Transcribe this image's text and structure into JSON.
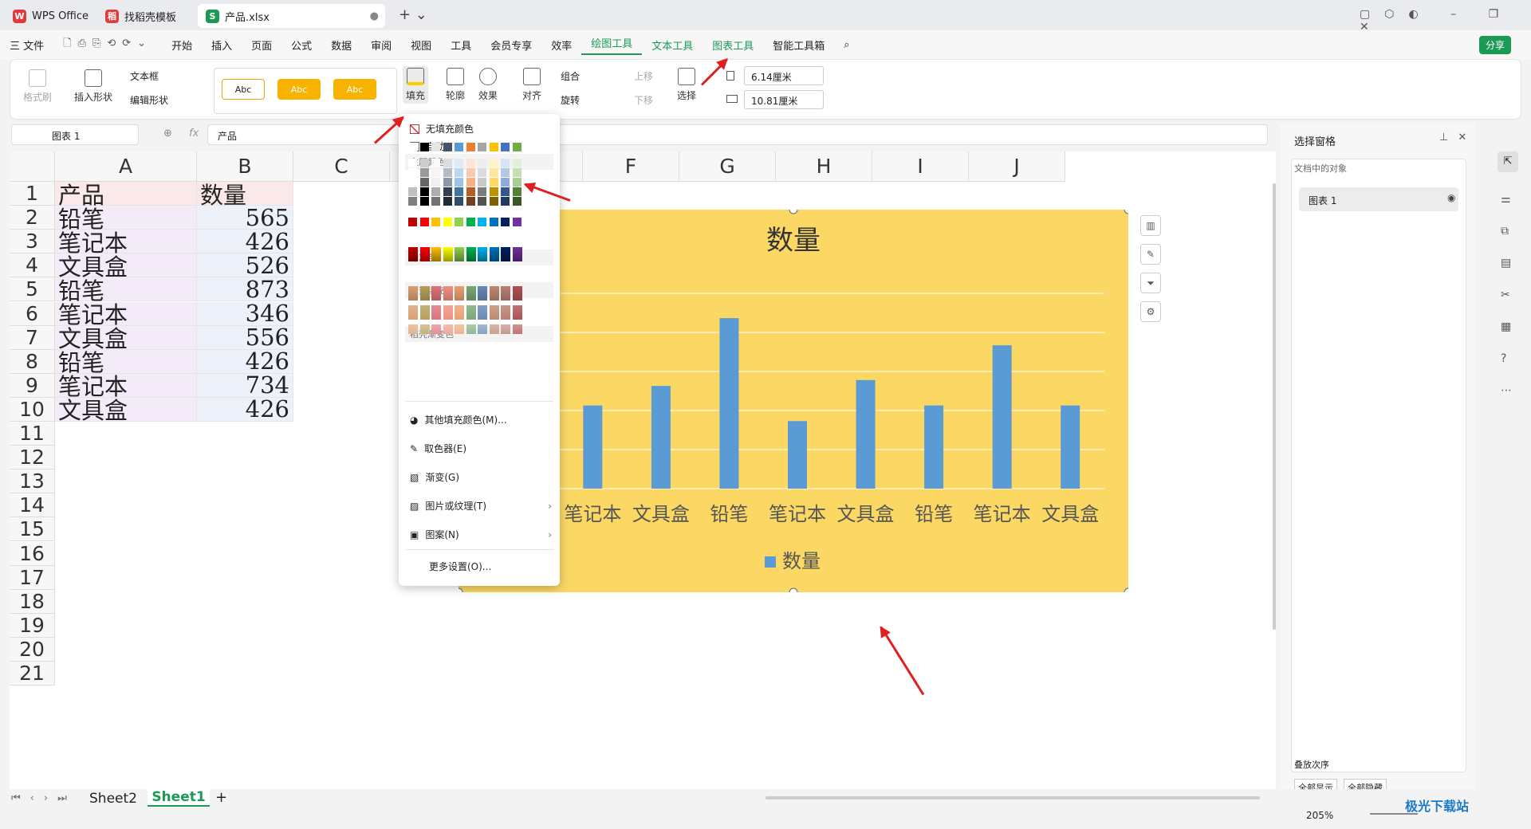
{
  "tabs": [
    {
      "label": "WPS Office",
      "logo": "W",
      "color": "#e23b3b"
    },
    {
      "label": "找稻壳模板",
      "logo": "稻",
      "color": "#e23b3b"
    },
    {
      "label": "产品.xlsx",
      "logo": "S",
      "color": "#1b9a56"
    }
  ],
  "menu": {
    "file": "三 文件",
    "items": [
      "开始",
      "插入",
      "页面",
      "公式",
      "数据",
      "审阅",
      "视图",
      "工具",
      "会员专享",
      "效率",
      "绘图工具",
      "文本工具",
      "图表工具",
      "智能工具箱"
    ],
    "share": "分享"
  },
  "ribbon": {
    "format_brush": "格式刷",
    "insert_shape": "插入形状",
    "text_box": "文本框",
    "edit_shape": "编辑形状",
    "style_label": "Abc",
    "fill": "填充",
    "outline": "轮廓",
    "effect": "效果",
    "align": "对齐",
    "group": "组合",
    "rotate": "旋转",
    "bring_up": "上移",
    "send_down": "下移",
    "select": "选择",
    "width": "6.14厘米",
    "height": "10.81厘米"
  },
  "formula": {
    "name_box": "图表 1",
    "fx": "fx",
    "content": "产品"
  },
  "sheet": {
    "columns": [
      "A",
      "B",
      "C",
      "D",
      "E",
      "F",
      "G",
      "H",
      "I",
      "J"
    ],
    "rows": [
      "1",
      "2",
      "3",
      "4",
      "5",
      "6",
      "7",
      "8",
      "9",
      "10",
      "11",
      "12",
      "13",
      "14",
      "15",
      "16",
      "17",
      "18",
      "19",
      "20",
      "21"
    ],
    "data": [
      [
        "产品",
        "数量"
      ],
      [
        "铅笔",
        "565"
      ],
      [
        "笔记本",
        "426"
      ],
      [
        "文具盒",
        "526"
      ],
      [
        "铅笔",
        "873"
      ],
      [
        "笔记本",
        "346"
      ],
      [
        "文具盒",
        "556"
      ],
      [
        "铅笔",
        "426"
      ],
      [
        "笔记本",
        "734"
      ],
      [
        "文具盒",
        "426"
      ]
    ]
  },
  "chart_data": {
    "type": "bar",
    "title": "数量",
    "categories": [
      "铅笔",
      "笔记本",
      "文具盒",
      "铅笔",
      "笔记本",
      "文具盒",
      "铅笔",
      "笔记本",
      "文具盒"
    ],
    "series": [
      {
        "name": "数量",
        "values": [
          565,
          426,
          526,
          873,
          346,
          556,
          426,
          734,
          426
        ]
      }
    ],
    "ylim": [
      0,
      1000
    ],
    "grid": true,
    "legend": "bottom",
    "colors": {
      "bar": "#5b9bd5",
      "background": "#fbd764"
    }
  },
  "dropdown": {
    "no_fill": "无填充颜色",
    "auto": "自动",
    "theme": "主题颜色",
    "standard": "标准色",
    "gradient": "渐变填充",
    "daoke_gradient": "稻壳渐变色",
    "more_colors": "其他填充颜色(M)...",
    "eyedropper": "取色器(E)",
    "gradient_item": "渐变(G)",
    "picture": "图片或纹理(T)",
    "pattern": "图案(N)",
    "more_settings": "更多设置(O)..."
  },
  "panel": {
    "title": "选择窗格",
    "subtitle": "文档中的对象",
    "item": "图表 1",
    "order": "叠放次序",
    "show_all": "全部显示",
    "hide_all": "全部隐藏"
  },
  "sheets": {
    "tabs": [
      "Sheet2",
      "Sheet1"
    ],
    "active": "Sheet1"
  },
  "status": {
    "zoom": "205%"
  },
  "watermark": "极光下载站"
}
